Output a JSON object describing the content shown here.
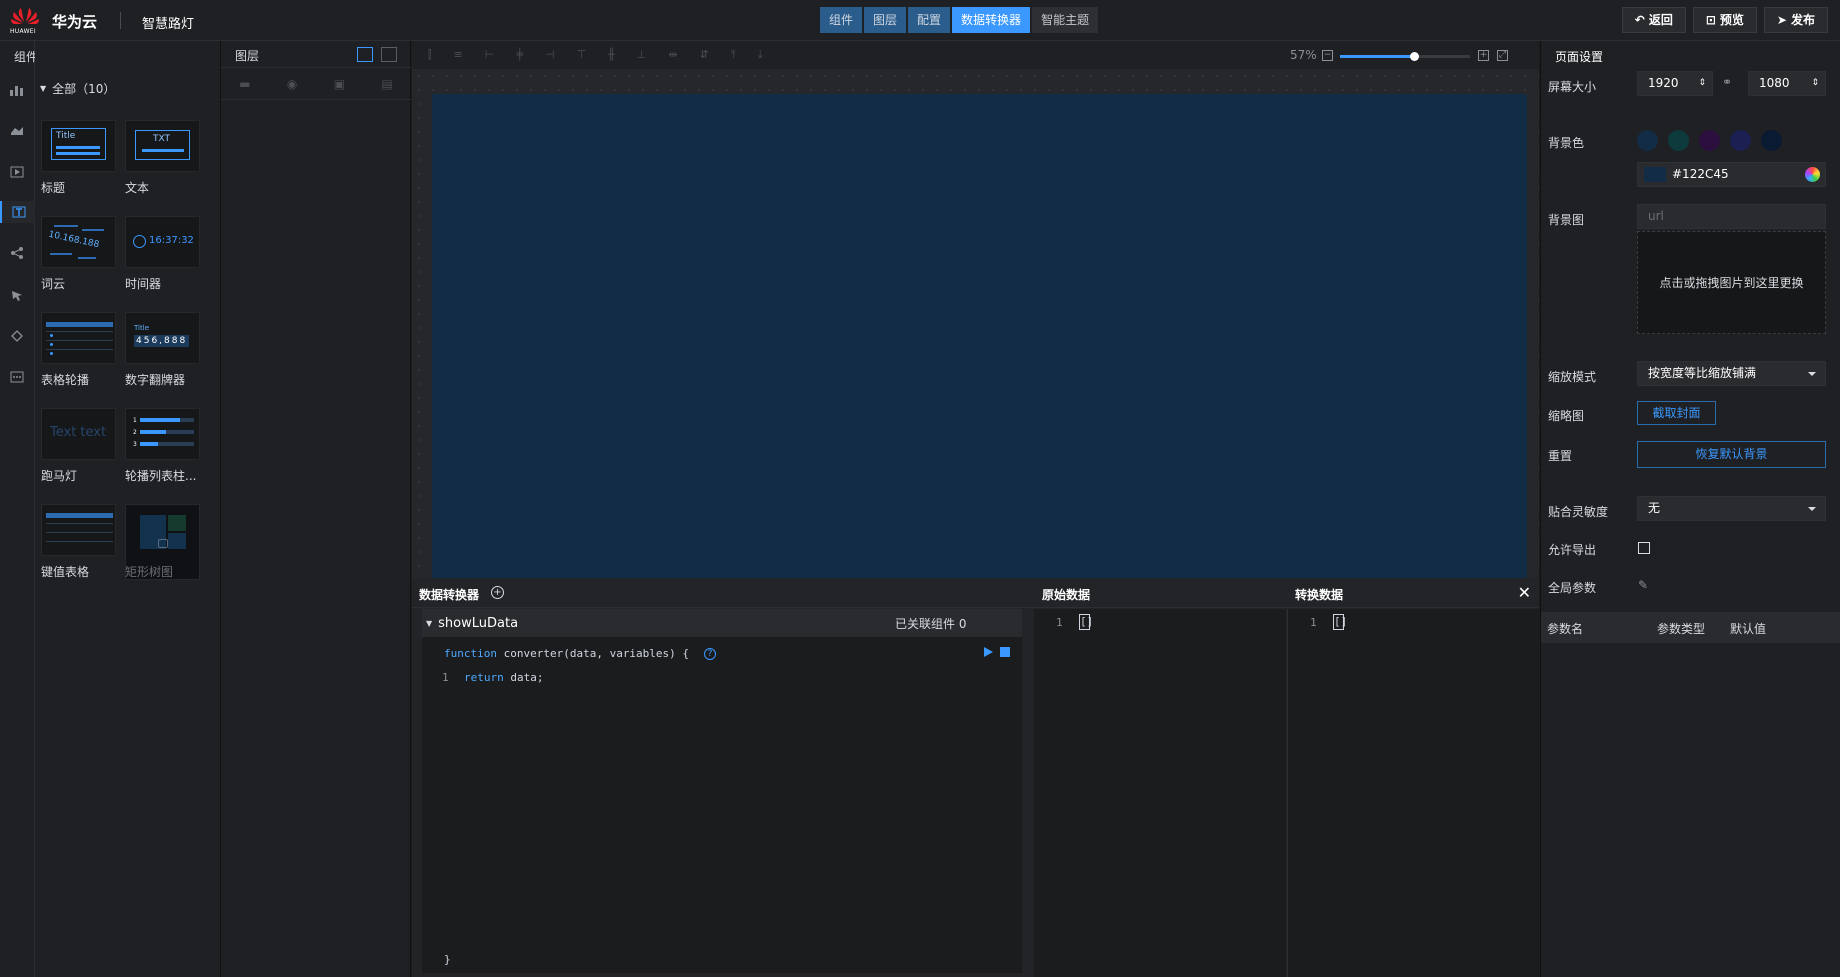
{
  "app": {
    "logo_text": "HUAWEI",
    "brand": "华为云",
    "project_name": "智慧路灯",
    "tabs": [
      {
        "label": "组件"
      },
      {
        "label": "图层"
      },
      {
        "label": "配置"
      },
      {
        "label": "数据转换器",
        "active": true
      },
      {
        "label": "智能主题"
      }
    ],
    "actions": {
      "back": "返回",
      "preview": "预览",
      "publish": "发布"
    },
    "accent_color": "#3a98ff"
  },
  "components": {
    "header": "组件",
    "tree_label": "全部（10）",
    "items": [
      {
        "label": "标题",
        "thumb_text": "Title"
      },
      {
        "label": "文本",
        "thumb_text": "TXT"
      },
      {
        "label": "词云",
        "thumb_text": "10.168.188"
      },
      {
        "label": "时间器",
        "thumb_text": "16:37:32"
      },
      {
        "label": "表格轮播"
      },
      {
        "label": "数字翻牌器",
        "thumb_text": "456,888",
        "thumb_title": "Title"
      },
      {
        "label": "跑马灯",
        "thumb_text": "Text text"
      },
      {
        "label": "轮播列表柱...",
        "thumb_rows": [
          "1",
          "2",
          "3"
        ]
      },
      {
        "label": "键值表格"
      },
      {
        "label": "矩形树图",
        "disabled": true
      }
    ]
  },
  "layers": {
    "header": "图层"
  },
  "canvas": {
    "zoom": "57%",
    "zoom_level": 0.57,
    "background": "#122C45"
  },
  "converter": {
    "title": "数据转换器",
    "name": "showLuData",
    "linked": "已关联组件 0",
    "code": {
      "signature_kw": "function",
      "signature_rest": " converter(data, variables) {",
      "line_no": "1",
      "body_kw": "return",
      "body_rest": " data;",
      "end": "}"
    },
    "raw_title": "原始数据",
    "raw_line": "1",
    "raw_value": "[]",
    "converted_title": "转换数据",
    "converted_line": "1",
    "converted_value": "[]"
  },
  "settings": {
    "title": "页面设置",
    "screen_size_label": "屏幕大小",
    "width": "1920",
    "height": "1080",
    "bg_color_label": "背景色",
    "swatches": [
      "#122c45",
      "#0d3b3d",
      "#2c0f3e",
      "#1c1f52",
      "#0a1a33"
    ],
    "bg_color_value": "#122C45",
    "bg_image_label": "背景图",
    "bg_image_placeholder": "url",
    "upload_hint": "点击或拖拽图片到这里更换",
    "scale_mode_label": "缩放模式",
    "scale_mode_value": "按宽度等比缩放铺满",
    "thumbnail_label": "缩略图",
    "capture_button": "截取封面",
    "reset_label": "重置",
    "restore_button": "恢复默认背景",
    "snap_label": "贴合灵敏度",
    "snap_value": "无",
    "export_label": "允许导出",
    "global_params_label": "全局参数",
    "params_columns": [
      "参数名",
      "参数类型",
      "默认值"
    ]
  }
}
